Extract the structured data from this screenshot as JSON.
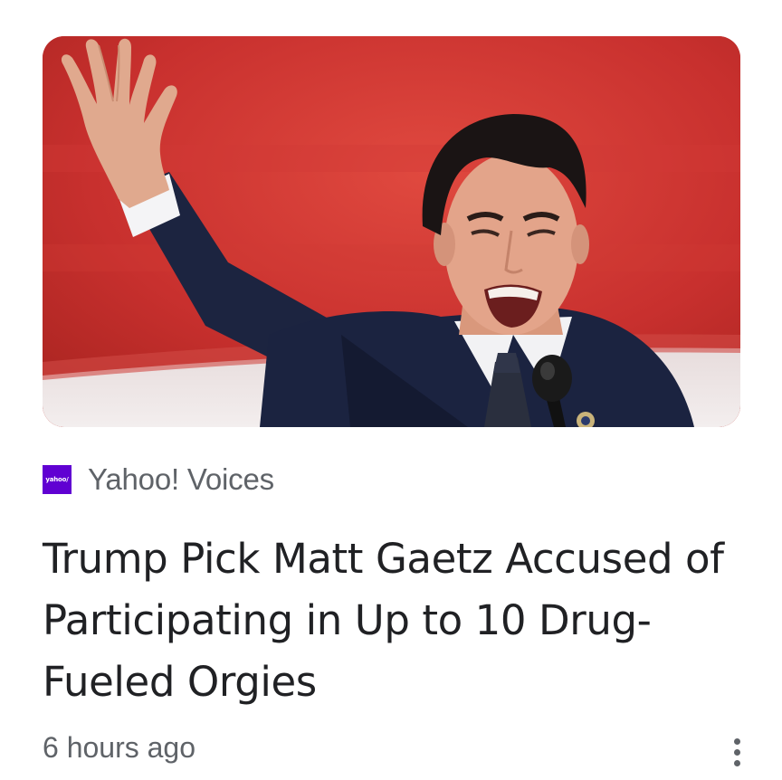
{
  "article": {
    "source": {
      "logo_text": "yahoo/",
      "name": "Yahoo! Voices"
    },
    "headline": "Trump Pick Matt Gaetz Accused of Participating in Up to 10 Drug-Fueled Orgies",
    "timestamp": "6 hours ago",
    "more_icon": "more-vert-icon"
  },
  "colors": {
    "headline_text": "#202124",
    "meta_text": "#5f6368",
    "source_logo_bg": "#6001d2",
    "thumbnail_bg": "#c8302e"
  }
}
